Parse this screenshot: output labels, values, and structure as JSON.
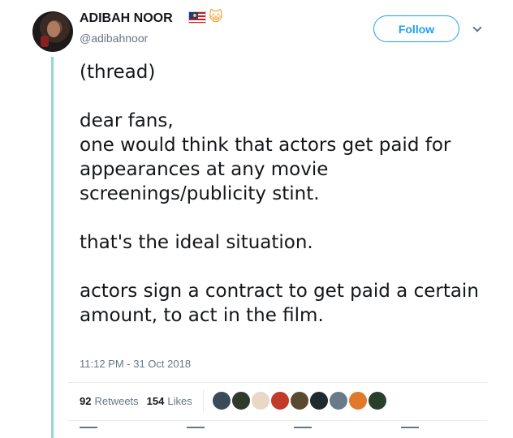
{
  "author": {
    "display_name": "ADIBAH NOOR",
    "handle": "@adibahnoor",
    "emoji_icons": [
      "malaysia-flag-icon",
      "smiling-cat-icon"
    ]
  },
  "follow_button": {
    "label": "Follow"
  },
  "tweet": {
    "paragraphs": [
      "(thread)",
      "dear fans,\none would think that actors get paid for appearances at any movie screenings/publicity stint.",
      "that's the ideal situation.",
      "actors sign a contract to get paid a certain amount, to act in the film."
    ],
    "timestamp": "11:12 PM - 31 Oct 2018"
  },
  "stats": {
    "retweets_count": "92",
    "retweets_label": "Retweets",
    "likes_count": "154",
    "likes_label": "Likes"
  },
  "likers": {
    "avatar_colors": [
      "#3c4a5a",
      "#2f3b2a",
      "#e9d7c8",
      "#c23a2a",
      "#5a4a30",
      "#1f2a2f",
      "#6a7a8a",
      "#e07a2a",
      "#2a3f2a"
    ]
  },
  "colors": {
    "accent": "#1da1f2",
    "thread_line": "#92d6d6",
    "secondary_text": "#657786",
    "primary_text": "#14171a"
  }
}
